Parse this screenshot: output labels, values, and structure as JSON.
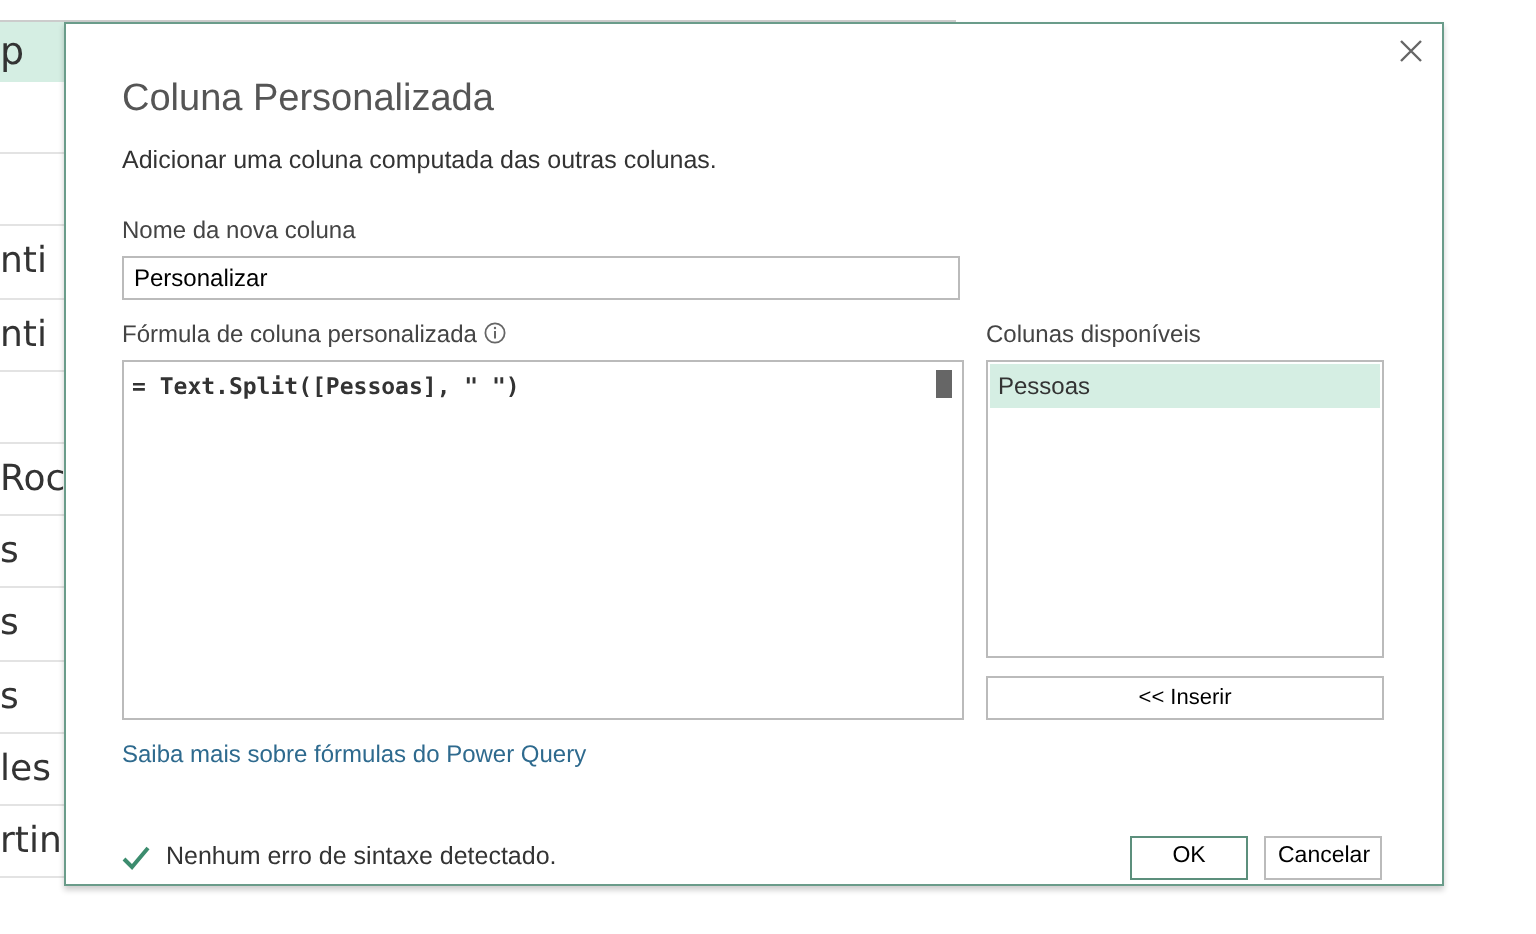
{
  "background_table": {
    "header": "p",
    "rows": [
      "",
      "",
      "nti",
      "nti",
      "",
      "Roc",
      "s",
      "s",
      "s",
      "les",
      "rtin"
    ]
  },
  "dialog": {
    "title": "Coluna Personalizada",
    "description": "Adicionar uma coluna computada das outras colunas.",
    "name_label": "Nome da nova coluna",
    "name_value": "Personalizar",
    "formula_label": "Fórmula de coluna personalizada",
    "formula_value": "= Text.Split([Pessoas], \" \")",
    "available_label": "Colunas disponíveis",
    "available_columns": [
      {
        "label": "Pessoas",
        "selected": true
      }
    ],
    "insert_button": "<< Inserir",
    "help_link": "Saiba mais sobre fórmulas do Power Query",
    "status": "Nenhum erro de sintaxe detectado.",
    "buttons": [
      {
        "label": "OK",
        "kind": "primary"
      },
      {
        "label": "Cancelar",
        "kind": "secondary"
      }
    ]
  }
}
